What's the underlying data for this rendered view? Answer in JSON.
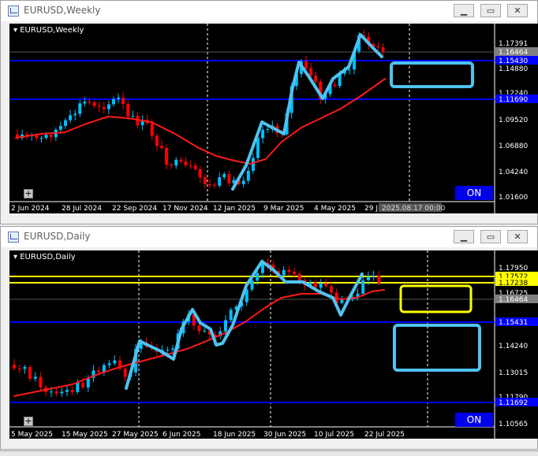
{
  "top_window": {
    "title": "EURUSD,Weekly",
    "symbol_label": "EURUSD,Weekly",
    "on_label": "ON",
    "buttons": {
      "minimize": "▁",
      "restore": "▭",
      "close": "✕"
    },
    "price_labels": [
      "1.17391",
      "1.16464",
      "1.15430",
      "1.14880",
      "1.12240",
      "1.11690",
      "1.09520",
      "1.06880",
      "1.04240",
      "1.01600"
    ],
    "date_labels": [
      "2 Jun 2024",
      "28 Jul 2024",
      "22 Sep 2024",
      "17 Nov 2024",
      "12 Jan 2025",
      "9 Mar 2025",
      "4 May 2025",
      "29 J"
    ],
    "cursor_date_label": "2025.08.17 00:00"
  },
  "bottom_window": {
    "title": "EURUSD,Daily",
    "symbol_label": "EURUSD,Daily",
    "on_label": "ON",
    "buttons": {
      "minimize": "▁",
      "restore": "▭",
      "close": "✕"
    },
    "price_labels": [
      "1.17950",
      "1.17572",
      "1.17238",
      "1.16725",
      "1.16464",
      "1.15431",
      "1.14240",
      "1.13015",
      "1.11790",
      "1.11692",
      "1.10565"
    ],
    "date_labels": [
      "5 May 2025",
      "15 May 2025",
      "27 May 2025",
      "6 Jun 2025",
      "18 Jun 2025",
      "30 Jun 2025",
      "10 Jul 2025",
      "22 Jul 2025"
    ]
  },
  "colors": {
    "background": "#000000",
    "bull_candle": "#00bfff",
    "bear_candle": "#ff0000",
    "moving_average": "#ff1a1a",
    "support_line": "#0000ff",
    "resistance_line": "#ffff00",
    "zigzag": "#4ec3f0",
    "on_badge": "#0000e8"
  }
}
